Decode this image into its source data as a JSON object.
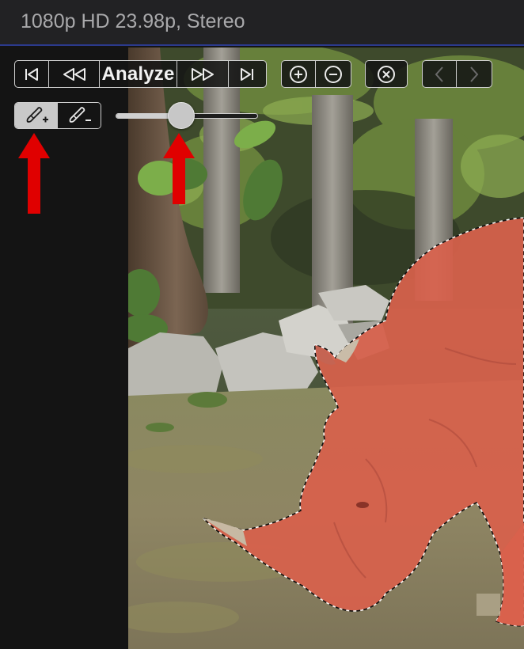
{
  "header": {
    "format_label": "1080p HD 23.98p, Stereo"
  },
  "toolbar": {
    "analyze_label": "Analyze",
    "buttons": {
      "go_to_start": "skip-to-start-icon",
      "rewind": "rewind-icon",
      "fast_forward": "fast-forward-icon",
      "go_to_end": "skip-to-end-icon",
      "zoom_in": "plus-circle-icon",
      "zoom_out": "minus-circle-icon",
      "clear": "close-circle-icon",
      "previous": "chevron-left-icon",
      "next": "chevron-right-icon"
    }
  },
  "brush_tools": {
    "add_brush": {
      "icon": "brush-add-icon",
      "active": true
    },
    "subtract_brush": {
      "icon": "brush-subtract-icon",
      "active": false
    }
  },
  "brush_size_slider": {
    "value": 0.45
  },
  "annotations": {
    "arrow_color": "#e00000"
  },
  "mask": {
    "overlay_color": "#d9614c",
    "overlay_opacity": 0.92
  }
}
